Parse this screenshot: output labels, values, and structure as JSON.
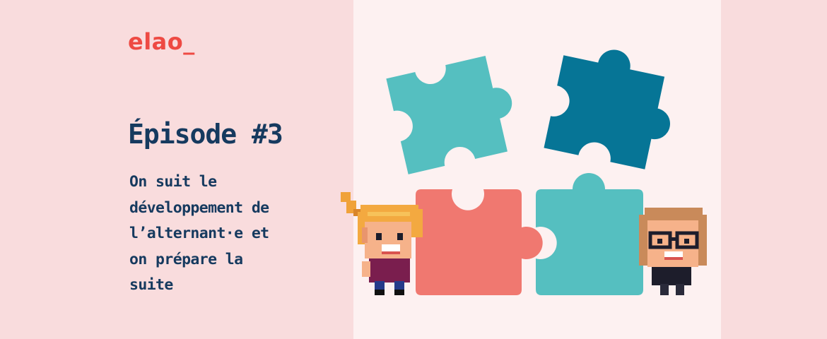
{
  "brand": {
    "logo_text": "elao_"
  },
  "episode": {
    "title": "Épisode #3",
    "subtitle": "On suit le\ndéveloppement de\nl’alternant·e et\non prépare la\nsuite"
  },
  "colors": {
    "background": "#f9dcdd",
    "panel": "#fdf1f1",
    "logo": "#ee4a43",
    "text": "#163a5f",
    "puzzle_teal": "#55bfc0",
    "puzzle_dark_teal": "#067596",
    "puzzle_coral": "#f07870"
  },
  "illustration": {
    "icons": [
      "puzzle-piece-icon",
      "pixel-character-left",
      "pixel-character-right"
    ]
  }
}
